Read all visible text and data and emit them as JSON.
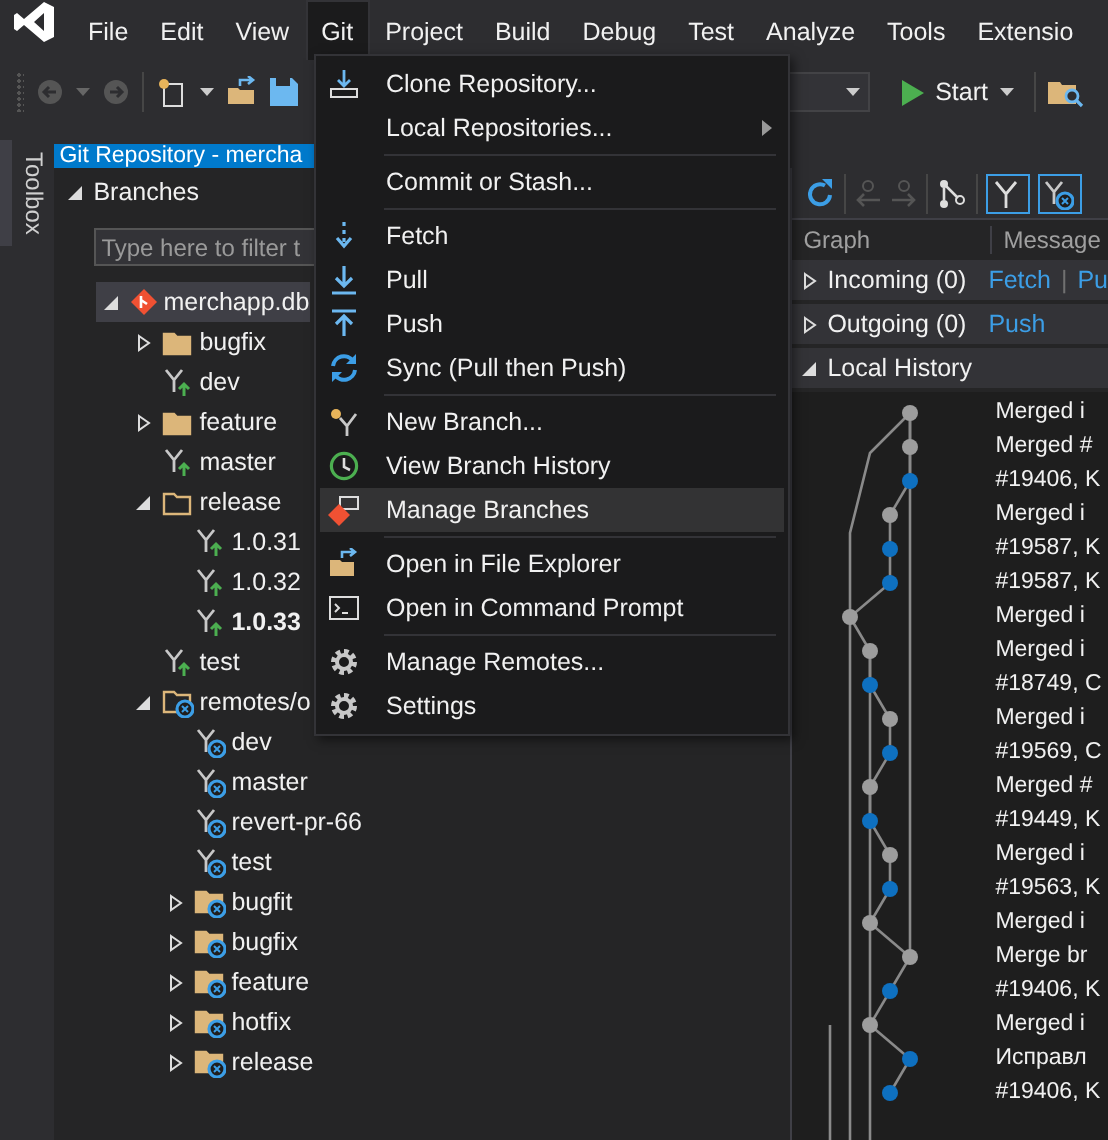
{
  "menu_bar": [
    {
      "label": "File",
      "selected": false
    },
    {
      "label": "Edit",
      "selected": false
    },
    {
      "label": "View",
      "selected": false
    },
    {
      "label": "Git",
      "selected": true
    },
    {
      "label": "Project",
      "selected": false
    },
    {
      "label": "Build",
      "selected": false
    },
    {
      "label": "Debug",
      "selected": false
    },
    {
      "label": "Test",
      "selected": false
    },
    {
      "label": "Analyze",
      "selected": false
    },
    {
      "label": "Tools",
      "selected": false
    },
    {
      "label": "Extensio",
      "selected": false
    }
  ],
  "toolbar": {
    "start_label": "Start"
  },
  "side_tab": "Toolbox",
  "panel": {
    "title": "Git Repository - mercha"
  },
  "branches": {
    "header": "Branches",
    "expanded": true,
    "filter_placeholder": "Type here to filter t",
    "tree": [
      {
        "label": "merchapp.db",
        "kind": "repo",
        "expanded": true,
        "selected": true,
        "current": false,
        "children": [
          {
            "label": "bugfix",
            "kind": "folder",
            "expanded": false,
            "selected": false,
            "current": false
          },
          {
            "label": "dev",
            "kind": "branch",
            "selected": false,
            "current": false
          },
          {
            "label": "feature",
            "kind": "folder",
            "expanded": false,
            "selected": false,
            "current": false
          },
          {
            "label": "master",
            "kind": "branch",
            "selected": false,
            "current": false
          },
          {
            "label": "release",
            "kind": "folder",
            "expanded": true,
            "selected": false,
            "current": false,
            "children": [
              {
                "label": "1.0.31",
                "kind": "branch",
                "selected": false,
                "current": false
              },
              {
                "label": "1.0.32",
                "kind": "branch",
                "selected": false,
                "current": false
              },
              {
                "label": "1.0.33",
                "kind": "branch",
                "selected": false,
                "current": true
              }
            ]
          },
          {
            "label": "test",
            "kind": "branch",
            "selected": false,
            "current": false
          },
          {
            "label": "remotes/o",
            "kind": "remote",
            "expanded": true,
            "selected": false,
            "current": false,
            "children": [
              {
                "label": "dev",
                "kind": "remote-branch",
                "selected": false,
                "current": false
              },
              {
                "label": "master",
                "kind": "remote-branch",
                "selected": false,
                "current": false
              },
              {
                "label": "revert-pr-66",
                "kind": "remote-branch",
                "selected": false,
                "current": false
              },
              {
                "label": "test",
                "kind": "remote-branch",
                "selected": false,
                "current": false
              },
              {
                "label": "bugfit",
                "kind": "remote-folder",
                "expanded": false,
                "selected": false,
                "current": false
              },
              {
                "label": "bugfix",
                "kind": "remote-folder",
                "expanded": false,
                "selected": false,
                "current": false
              },
              {
                "label": "feature",
                "kind": "remote-folder",
                "expanded": false,
                "selected": false,
                "current": false
              },
              {
                "label": "hotfix",
                "kind": "remote-folder",
                "expanded": false,
                "selected": false,
                "current": false
              },
              {
                "label": "release",
                "kind": "remote-folder",
                "expanded": false,
                "selected": false,
                "current": false
              }
            ]
          }
        ]
      }
    ]
  },
  "history": {
    "toggles": [
      {
        "selected": true
      },
      {
        "selected": true
      }
    ],
    "columns": [
      "Graph",
      "Message"
    ],
    "incoming": {
      "label": "Incoming (0)",
      "expanded": false,
      "links": [
        "Fetch",
        "Pu"
      ],
      "separator": "|"
    },
    "outgoing": {
      "label": "Outgoing (0)",
      "expanded": false,
      "links": [
        "Push"
      ]
    },
    "local": {
      "label": "Local History",
      "expanded": true
    },
    "commits": [
      {
        "message": "Merged i",
        "color": "#9d9d9d"
      },
      {
        "message": "Merged #",
        "color": "#9d9d9d"
      },
      {
        "message": "#19406, K",
        "color": "#0e70c0"
      },
      {
        "message": "Merged i",
        "color": "#9d9d9d"
      },
      {
        "message": "#19587, K",
        "color": "#0e70c0"
      },
      {
        "message": "#19587, K",
        "color": "#0e70c0"
      },
      {
        "message": "Merged i",
        "color": "#9d9d9d"
      },
      {
        "message": "Merged i",
        "color": "#9d9d9d"
      },
      {
        "message": "#18749, C",
        "color": "#0e70c0"
      },
      {
        "message": "Merged i",
        "color": "#9d9d9d"
      },
      {
        "message": "#19569, C",
        "color": "#0e70c0"
      },
      {
        "message": "Merged #",
        "color": "#9d9d9d"
      },
      {
        "message": "#19449, K",
        "color": "#0e70c0"
      },
      {
        "message": "Merged i",
        "color": "#9d9d9d"
      },
      {
        "message": "#19563, K",
        "color": "#0e70c0"
      },
      {
        "message": "Merged i",
        "color": "#9d9d9d"
      },
      {
        "message": "Merge br",
        "color": "#9d9d9d"
      },
      {
        "message": "#19406, K",
        "color": "#0e70c0"
      },
      {
        "message": "Merged i",
        "color": "#9d9d9d"
      },
      {
        "message": "Исправл",
        "color": "#0e70c0"
      },
      {
        "message": "#19406, K",
        "color": "#0e70c0"
      }
    ]
  },
  "git_menu": {
    "groups": [
      [
        {
          "label": "Clone Repository...",
          "submenu": false,
          "selected": false
        },
        {
          "label": "Local Repositories...",
          "submenu": true,
          "selected": false
        }
      ],
      [
        {
          "label": "Commit or Stash...",
          "submenu": false,
          "selected": false
        }
      ],
      [
        {
          "label": "Fetch",
          "submenu": false,
          "selected": false
        },
        {
          "label": "Pull",
          "submenu": false,
          "selected": false
        },
        {
          "label": "Push",
          "submenu": false,
          "selected": false
        },
        {
          "label": "Sync (Pull then Push)",
          "submenu": false,
          "selected": false
        }
      ],
      [
        {
          "label": "New Branch...",
          "submenu": false,
          "selected": false
        },
        {
          "label": "View Branch History",
          "submenu": false,
          "selected": false
        },
        {
          "label": "Manage Branches",
          "submenu": false,
          "selected": true
        }
      ],
      [
        {
          "label": "Open in File Explorer",
          "submenu": false,
          "selected": false
        },
        {
          "label": "Open in Command Prompt",
          "submenu": false,
          "selected": false
        }
      ],
      [
        {
          "label": "Manage Remotes...",
          "submenu": false,
          "selected": false
        },
        {
          "label": "Settings",
          "submenu": false,
          "selected": false
        }
      ]
    ]
  }
}
